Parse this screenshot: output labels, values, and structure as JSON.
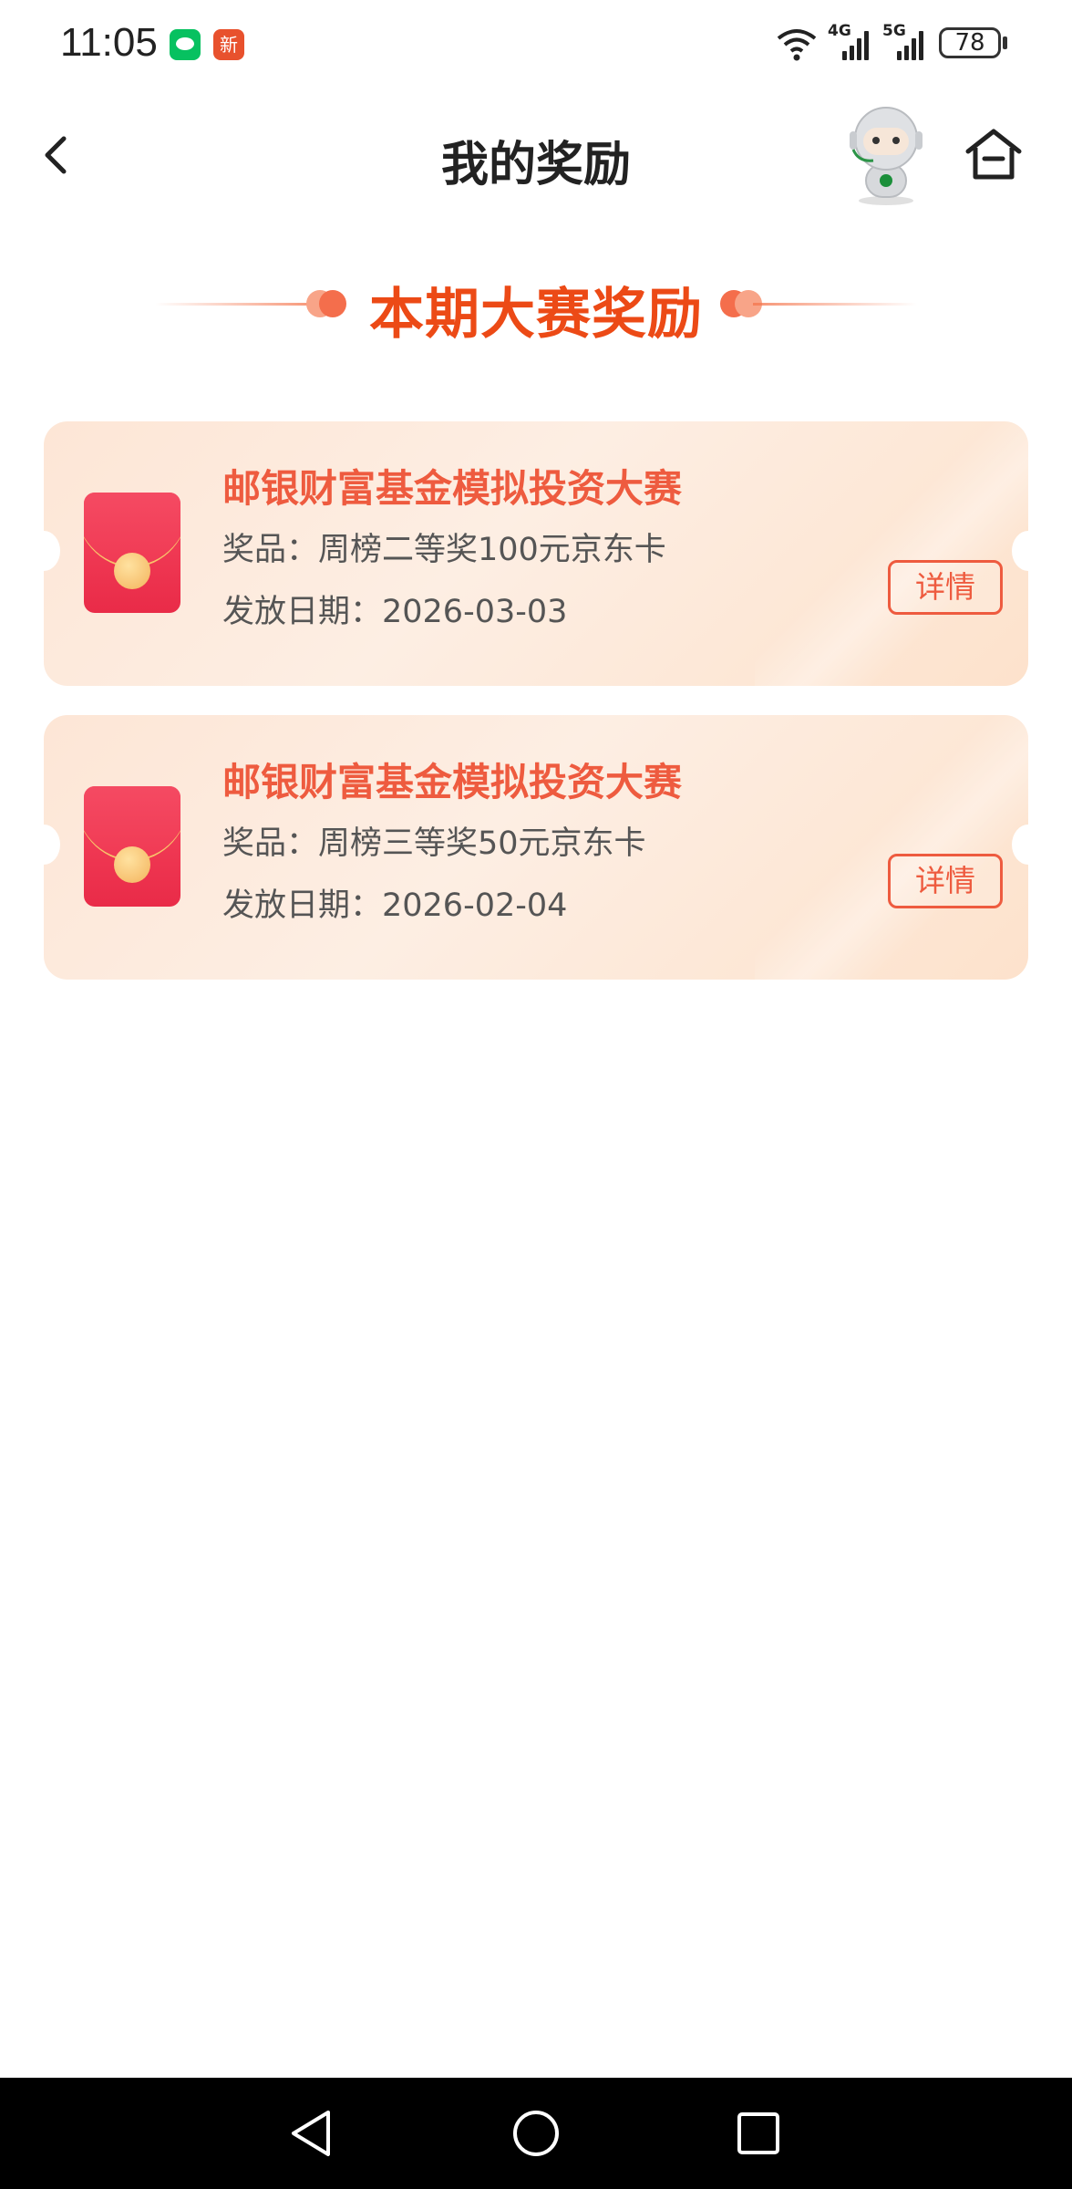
{
  "status_bar": {
    "time": "11:05",
    "news_badge_text": "新",
    "network_1": "4G",
    "network_2": "5G",
    "battery": "78"
  },
  "header": {
    "title": "我的奖励"
  },
  "section": {
    "heading": "本期大赛奖励"
  },
  "rewards": [
    {
      "title": "邮银财富基金模拟投资大赛",
      "prize": "奖品：周榜二等奖100元京东卡",
      "date": "发放日期：2026-03-03",
      "button": "详情"
    },
    {
      "title": "邮银财富基金模拟投资大赛",
      "prize": "奖品：周榜三等奖50元京东卡",
      "date": "发放日期：2026-02-04",
      "button": "详情"
    }
  ],
  "colors": {
    "accent": "#ec4a16",
    "card_title": "#ee5b3f",
    "card_bg": "#fde6d6",
    "envelope": "#e92b48"
  },
  "icons": {
    "back": "chevron-left-icon",
    "assistant": "robot-avatar",
    "home": "home-icon",
    "reward": "red-envelope-icon"
  }
}
